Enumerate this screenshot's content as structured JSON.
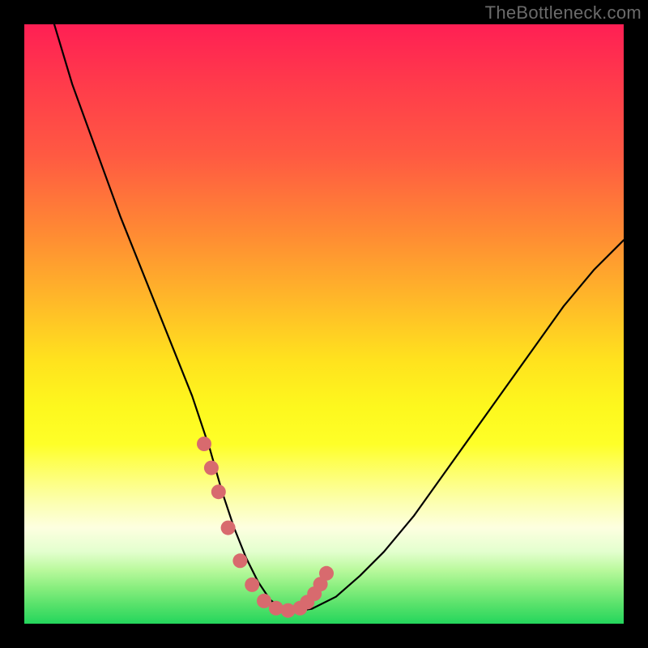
{
  "watermark": "TheBottleneck.com",
  "chart_data": {
    "type": "line",
    "title": "",
    "xlabel": "",
    "ylabel": "",
    "xlim": [
      0,
      100
    ],
    "ylim": [
      0,
      100
    ],
    "series": [
      {
        "name": "bottleneck-curve",
        "x": [
          5,
          8,
          12,
          16,
          20,
          24,
          28,
          31,
          33,
          35,
          37,
          39,
          41,
          43,
          45,
          48,
          52,
          56,
          60,
          65,
          70,
          75,
          80,
          85,
          90,
          95,
          100
        ],
        "values": [
          100,
          90,
          79,
          68,
          58,
          48,
          38,
          29,
          22,
          16,
          11,
          7,
          4,
          2.5,
          2,
          2.5,
          4.5,
          8,
          12,
          18,
          25,
          32,
          39,
          46,
          53,
          59,
          64
        ]
      }
    ],
    "highlight_dots": {
      "name": "curve-marker",
      "x": [
        30,
        31.2,
        32.4,
        34,
        36,
        38,
        40,
        42,
        44,
        46,
        47.2,
        48.4,
        49.4,
        50.4
      ],
      "values": [
        30,
        26,
        22,
        16,
        10.5,
        6.5,
        3.8,
        2.6,
        2.2,
        2.6,
        3.6,
        5.0,
        6.6,
        8.4
      ]
    },
    "gradient_stops": [
      {
        "pos": 0,
        "meaning": "worst",
        "color": "#ff1f54"
      },
      {
        "pos": 50,
        "meaning": "mid",
        "color": "#ffe21e"
      },
      {
        "pos": 100,
        "meaning": "best",
        "color": "#24d65c"
      }
    ]
  }
}
